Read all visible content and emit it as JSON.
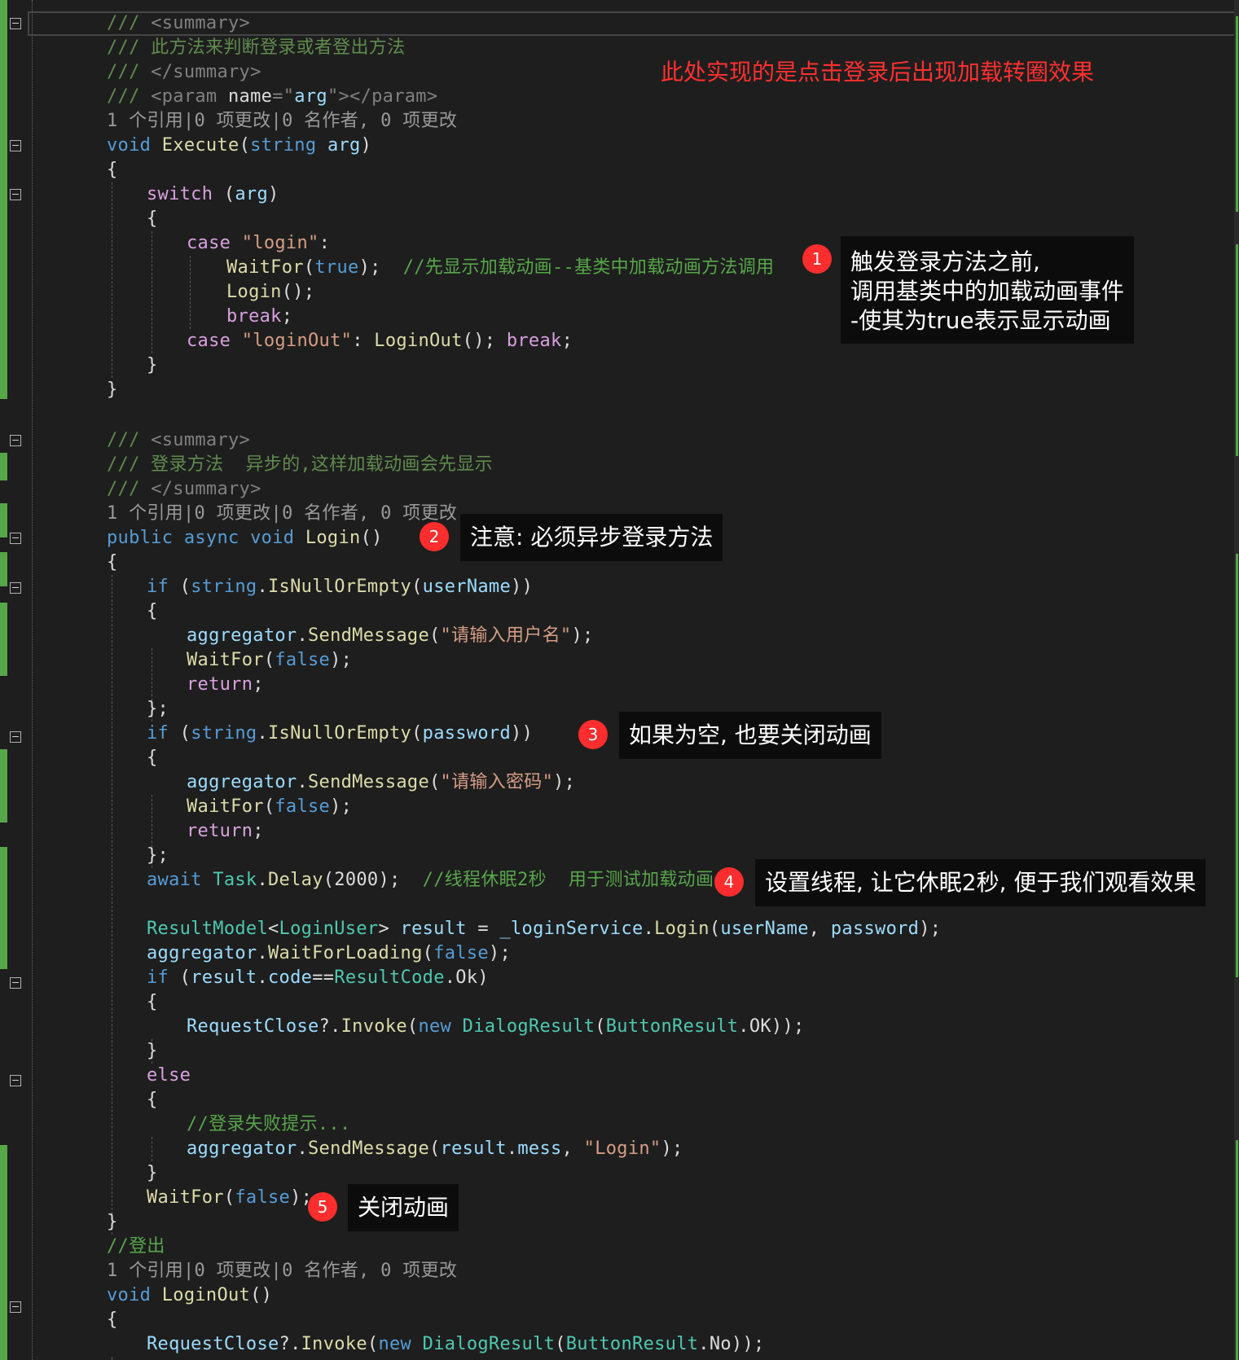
{
  "editor": {
    "lines": [
      {
        "tokens": [
          {
            "t": "/// ",
            "c": "doc"
          },
          {
            "t": "<summary>",
            "c": "tag"
          }
        ]
      },
      {
        "tokens": [
          {
            "t": "/// 此方法来判断登录或者登出方法",
            "c": "doc"
          }
        ]
      },
      {
        "tokens": [
          {
            "t": "/// ",
            "c": "doc"
          },
          {
            "t": "</summary>",
            "c": "tag"
          }
        ]
      },
      {
        "tokens": [
          {
            "t": "/// ",
            "c": "doc"
          },
          {
            "t": "<param ",
            "c": "tag"
          },
          {
            "t": "name",
            "c": "pl"
          },
          {
            "t": "=\"",
            "c": "tag"
          },
          {
            "t": "arg",
            "c": "id"
          },
          {
            "t": "\"></param>",
            "c": "tag"
          }
        ]
      },
      {
        "tokens": [
          {
            "t": "1 个引用|0 项更改|0 名作者, 0 项更改",
            "c": "ref"
          }
        ]
      },
      {
        "tokens": [
          {
            "t": "void",
            "c": "kw"
          },
          {
            "t": " ",
            "c": "pl"
          },
          {
            "t": "Execute",
            "c": "fn"
          },
          {
            "t": "(",
            "c": "pl"
          },
          {
            "t": "string",
            "c": "kw"
          },
          {
            "t": " ",
            "c": "pl"
          },
          {
            "t": "arg",
            "c": "id"
          },
          {
            "t": ")",
            "c": "pl"
          }
        ]
      },
      {
        "tokens": [
          {
            "t": "{",
            "c": "pl"
          }
        ]
      },
      {
        "tokens": [
          {
            "t": "switch",
            "c": "ctl"
          },
          {
            "t": " (",
            "c": "pl"
          },
          {
            "t": "arg",
            "c": "id"
          },
          {
            "t": ")",
            "c": "pl"
          }
        ]
      },
      {
        "tokens": [
          {
            "t": "{",
            "c": "pl"
          }
        ]
      },
      {
        "tokens": [
          {
            "t": "case",
            "c": "ctl"
          },
          {
            "t": " ",
            "c": "pl"
          },
          {
            "t": "\"login\"",
            "c": "str"
          },
          {
            "t": ":",
            "c": "pl"
          }
        ]
      },
      {
        "tokens": [
          {
            "t": "WaitFor",
            "c": "fn"
          },
          {
            "t": "(",
            "c": "pl"
          },
          {
            "t": "true",
            "c": "kw"
          },
          {
            "t": ");  ",
            "c": "pl"
          },
          {
            "t": "//先显示加载动画--基类中加载动画方法调用",
            "c": "cmt"
          }
        ]
      },
      {
        "tokens": [
          {
            "t": "Login",
            "c": "fn"
          },
          {
            "t": "();",
            "c": "pl"
          }
        ]
      },
      {
        "tokens": [
          {
            "t": "break",
            "c": "ctl"
          },
          {
            "t": ";",
            "c": "pl"
          }
        ]
      },
      {
        "tokens": [
          {
            "t": "case",
            "c": "ctl"
          },
          {
            "t": " ",
            "c": "pl"
          },
          {
            "t": "\"loginOut\"",
            "c": "str"
          },
          {
            "t": ": ",
            "c": "pl"
          },
          {
            "t": "LoginOut",
            "c": "fn"
          },
          {
            "t": "(); ",
            "c": "pl"
          },
          {
            "t": "break",
            "c": "ctl"
          },
          {
            "t": ";",
            "c": "pl"
          }
        ]
      },
      {
        "tokens": [
          {
            "t": "}",
            "c": "pl"
          }
        ]
      },
      {
        "tokens": [
          {
            "t": "}",
            "c": "pl"
          }
        ]
      },
      {
        "tokens": [
          {
            "t": "/// ",
            "c": "doc"
          },
          {
            "t": "<summary>",
            "c": "tag"
          }
        ]
      },
      {
        "tokens": [
          {
            "t": "/// 登录方法  异步的,这样加载动画会先显示",
            "c": "doc"
          }
        ]
      },
      {
        "tokens": [
          {
            "t": "/// ",
            "c": "doc"
          },
          {
            "t": "</summary>",
            "c": "tag"
          }
        ]
      },
      {
        "tokens": [
          {
            "t": "1 个引用|0 项更改|0 名作者, 0 项更改",
            "c": "ref"
          }
        ]
      },
      {
        "tokens": [
          {
            "t": "public",
            "c": "kw"
          },
          {
            "t": " ",
            "c": "pl"
          },
          {
            "t": "async",
            "c": "kw"
          },
          {
            "t": " ",
            "c": "pl"
          },
          {
            "t": "void",
            "c": "kw"
          },
          {
            "t": " ",
            "c": "pl"
          },
          {
            "t": "Login",
            "c": "fn"
          },
          {
            "t": "()",
            "c": "pl"
          }
        ]
      },
      {
        "tokens": [
          {
            "t": "{",
            "c": "pl"
          }
        ]
      },
      {
        "tokens": [
          {
            "t": "if",
            "c": "kw"
          },
          {
            "t": " (",
            "c": "pl"
          },
          {
            "t": "string",
            "c": "kw"
          },
          {
            "t": ".",
            "c": "pl"
          },
          {
            "t": "IsNullOrEmpty",
            "c": "fn"
          },
          {
            "t": "(",
            "c": "pl"
          },
          {
            "t": "userName",
            "c": "id"
          },
          {
            "t": "))",
            "c": "pl"
          }
        ]
      },
      {
        "tokens": [
          {
            "t": "{",
            "c": "pl"
          }
        ]
      },
      {
        "tokens": [
          {
            "t": "aggregator",
            "c": "id"
          },
          {
            "t": ".",
            "c": "pl"
          },
          {
            "t": "SendMessage",
            "c": "fn"
          },
          {
            "t": "(",
            "c": "pl"
          },
          {
            "t": "\"请输入用户名\"",
            "c": "str"
          },
          {
            "t": ");",
            "c": "pl"
          }
        ]
      },
      {
        "tokens": [
          {
            "t": "WaitFor",
            "c": "fn"
          },
          {
            "t": "(",
            "c": "pl"
          },
          {
            "t": "false",
            "c": "kw"
          },
          {
            "t": ");",
            "c": "pl"
          }
        ]
      },
      {
        "tokens": [
          {
            "t": "return",
            "c": "ctl"
          },
          {
            "t": ";",
            "c": "pl"
          }
        ]
      },
      {
        "tokens": [
          {
            "t": "};",
            "c": "pl"
          }
        ]
      },
      {
        "tokens": [
          {
            "t": "if",
            "c": "kw"
          },
          {
            "t": " (",
            "c": "pl"
          },
          {
            "t": "string",
            "c": "kw"
          },
          {
            "t": ".",
            "c": "pl"
          },
          {
            "t": "IsNullOrEmpty",
            "c": "fn"
          },
          {
            "t": "(",
            "c": "pl"
          },
          {
            "t": "password",
            "c": "id"
          },
          {
            "t": "))",
            "c": "pl"
          }
        ]
      },
      {
        "tokens": [
          {
            "t": "{",
            "c": "pl"
          }
        ]
      },
      {
        "tokens": [
          {
            "t": "aggregator",
            "c": "id"
          },
          {
            "t": ".",
            "c": "pl"
          },
          {
            "t": "SendMessage",
            "c": "fn"
          },
          {
            "t": "(",
            "c": "pl"
          },
          {
            "t": "\"请输入密码\"",
            "c": "str"
          },
          {
            "t": ");",
            "c": "pl"
          }
        ]
      },
      {
        "tokens": [
          {
            "t": "WaitFor",
            "c": "fn"
          },
          {
            "t": "(",
            "c": "pl"
          },
          {
            "t": "false",
            "c": "kw"
          },
          {
            "t": ");",
            "c": "pl"
          }
        ]
      },
      {
        "tokens": [
          {
            "t": "return",
            "c": "ctl"
          },
          {
            "t": ";",
            "c": "pl"
          }
        ]
      },
      {
        "tokens": [
          {
            "t": "};",
            "c": "pl"
          }
        ]
      },
      {
        "tokens": [
          {
            "t": "await",
            "c": "kw"
          },
          {
            "t": " ",
            "c": "pl"
          },
          {
            "t": "Task",
            "c": "type"
          },
          {
            "t": ".",
            "c": "pl"
          },
          {
            "t": "Delay",
            "c": "fn"
          },
          {
            "t": "(2000);  ",
            "c": "pl"
          },
          {
            "t": "//线程休眠2秒  用于测试加载动画",
            "c": "cmt"
          }
        ]
      },
      {
        "tokens": [
          {
            "t": "ResultModel",
            "c": "type"
          },
          {
            "t": "<",
            "c": "pl"
          },
          {
            "t": "LoginUser",
            "c": "type"
          },
          {
            "t": "> ",
            "c": "pl"
          },
          {
            "t": "result",
            "c": "id"
          },
          {
            "t": " = ",
            "c": "pl"
          },
          {
            "t": "_loginService",
            "c": "id"
          },
          {
            "t": ".",
            "c": "pl"
          },
          {
            "t": "Login",
            "c": "fn"
          },
          {
            "t": "(",
            "c": "pl"
          },
          {
            "t": "userName",
            "c": "id"
          },
          {
            "t": ", ",
            "c": "pl"
          },
          {
            "t": "password",
            "c": "id"
          },
          {
            "t": ");",
            "c": "pl"
          }
        ]
      },
      {
        "tokens": [
          {
            "t": "aggregator",
            "c": "id"
          },
          {
            "t": ".",
            "c": "pl"
          },
          {
            "t": "WaitForLoading",
            "c": "fn"
          },
          {
            "t": "(",
            "c": "pl"
          },
          {
            "t": "false",
            "c": "kw"
          },
          {
            "t": ");",
            "c": "pl"
          }
        ]
      },
      {
        "tokens": [
          {
            "t": "if",
            "c": "kw"
          },
          {
            "t": " (",
            "c": "pl"
          },
          {
            "t": "result",
            "c": "id"
          },
          {
            "t": ".",
            "c": "pl"
          },
          {
            "t": "code",
            "c": "id"
          },
          {
            "t": "==",
            "c": "pl"
          },
          {
            "t": "ResultCode",
            "c": "type"
          },
          {
            "t": ".Ok)",
            "c": "pl"
          }
        ]
      },
      {
        "tokens": [
          {
            "t": "{",
            "c": "pl"
          }
        ]
      },
      {
        "tokens": [
          {
            "t": "RequestClose",
            "c": "id"
          },
          {
            "t": "?.",
            "c": "pl"
          },
          {
            "t": "Invoke",
            "c": "fn"
          },
          {
            "t": "(",
            "c": "pl"
          },
          {
            "t": "new",
            "c": "kw"
          },
          {
            "t": " ",
            "c": "pl"
          },
          {
            "t": "DialogResult",
            "c": "type"
          },
          {
            "t": "(",
            "c": "pl"
          },
          {
            "t": "ButtonResult",
            "c": "type"
          },
          {
            "t": ".OK));",
            "c": "pl"
          }
        ]
      },
      {
        "tokens": [
          {
            "t": "}",
            "c": "pl"
          }
        ]
      },
      {
        "tokens": [
          {
            "t": "else",
            "c": "ctl"
          }
        ]
      },
      {
        "tokens": [
          {
            "t": "{",
            "c": "pl"
          }
        ]
      },
      {
        "tokens": [
          {
            "t": "//登录失败提示...",
            "c": "cmt"
          }
        ]
      },
      {
        "tokens": [
          {
            "t": "aggregator",
            "c": "id"
          },
          {
            "t": ".",
            "c": "pl"
          },
          {
            "t": "SendMessage",
            "c": "fn"
          },
          {
            "t": "(",
            "c": "pl"
          },
          {
            "t": "result",
            "c": "id"
          },
          {
            "t": ".",
            "c": "pl"
          },
          {
            "t": "mess",
            "c": "id"
          },
          {
            "t": ", ",
            "c": "pl"
          },
          {
            "t": "\"Login\"",
            "c": "str"
          },
          {
            "t": ");",
            "c": "pl"
          }
        ]
      },
      {
        "tokens": [
          {
            "t": "}",
            "c": "pl"
          }
        ]
      },
      {
        "tokens": [
          {
            "t": "WaitFor",
            "c": "fn"
          },
          {
            "t": "(",
            "c": "pl"
          },
          {
            "t": "false",
            "c": "kw"
          },
          {
            "t": ");",
            "c": "pl"
          }
        ]
      },
      {
        "tokens": [
          {
            "t": "}",
            "c": "pl"
          }
        ]
      },
      {
        "tokens": [
          {
            "t": "//登出",
            "c": "cmt"
          }
        ]
      },
      {
        "tokens": [
          {
            "t": "1 个引用|0 项更改|0 名作者, 0 项更改",
            "c": "ref"
          }
        ]
      },
      {
        "tokens": [
          {
            "t": "void",
            "c": "kw"
          },
          {
            "t": " ",
            "c": "pl"
          },
          {
            "t": "LoginOut",
            "c": "fn"
          },
          {
            "t": "()",
            "c": "pl"
          }
        ]
      },
      {
        "tokens": [
          {
            "t": "{",
            "c": "pl"
          }
        ]
      },
      {
        "tokens": [
          {
            "t": "RequestClose",
            "c": "id"
          },
          {
            "t": "?.",
            "c": "pl"
          },
          {
            "t": "Invoke",
            "c": "fn"
          },
          {
            "t": "(",
            "c": "pl"
          },
          {
            "t": "new",
            "c": "kw"
          },
          {
            "t": " ",
            "c": "pl"
          },
          {
            "t": "DialogResult",
            "c": "type"
          },
          {
            "t": "(",
            "c": "pl"
          },
          {
            "t": "ButtonResult",
            "c": "type"
          },
          {
            "t": ".No));",
            "c": "pl"
          }
        ]
      }
    ]
  },
  "annotations": {
    "headline": "此处实现的是点击登录后出现加载转圈效果",
    "notes": [
      {
        "number": "1",
        "text": "触发登录方法之前,\n调用基类中的加载动画事件\n-使其为true表示显示动画"
      },
      {
        "number": "2",
        "text": "注意: 必须异步登录方法"
      },
      {
        "number": "3",
        "text": "如果为空, 也要关闭动画"
      },
      {
        "number": "4",
        "text": "设置线程, 让它休眠2秒, 便于我们观看效果"
      },
      {
        "number": "5",
        "text": "关闭动画"
      }
    ]
  },
  "colors": {
    "background": "#1e1e1e",
    "keyword": "#569cd6",
    "control": "#d8a0df",
    "comment": "#57a64a",
    "string": "#d69d85",
    "type": "#4ec9b0",
    "method": "#dcdcaa",
    "identifier": "#9cdcfe",
    "badge": "#ff2d2d",
    "headline": "#ff3030",
    "change_marker": "#57a64a"
  }
}
